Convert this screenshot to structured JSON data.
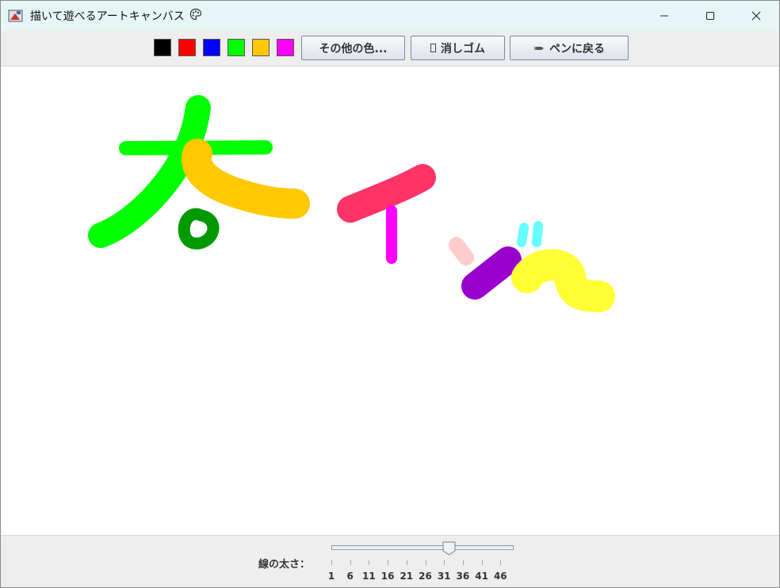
{
  "window": {
    "title": "描いて遊べるアートキャンバス",
    "title_emoji_icon": "palette-icon",
    "controls": [
      "minimize",
      "maximize",
      "close"
    ]
  },
  "toolbar": {
    "swatches": [
      {
        "name": "black",
        "color": "#000000"
      },
      {
        "name": "red",
        "color": "#ff0000"
      },
      {
        "name": "blue",
        "color": "#0000ff"
      },
      {
        "name": "green",
        "color": "#00ff00"
      },
      {
        "name": "orange",
        "color": "#ffc800"
      },
      {
        "name": "magenta",
        "color": "#ff00ff"
      }
    ],
    "more_colors_label": "その他の色...",
    "eraser_label": "消しゴム",
    "pen_label": "ペンに戻る"
  },
  "canvas": {
    "background": "#ffffff",
    "stroke_colors": [
      "#00ff00",
      "#ffc800",
      "#009900",
      "#ff3366",
      "#ff00ff",
      "#ffcccc",
      "#66ffff",
      "#9900cc",
      "#ffff33"
    ]
  },
  "bottom": {
    "thickness_label": "線の太さ：",
    "slider_value": 31,
    "slider_min": 1,
    "slider_max": 50,
    "tick_labels": [
      "1",
      "6",
      "11",
      "16",
      "21",
      "26",
      "31",
      "36",
      "41",
      "46"
    ]
  }
}
